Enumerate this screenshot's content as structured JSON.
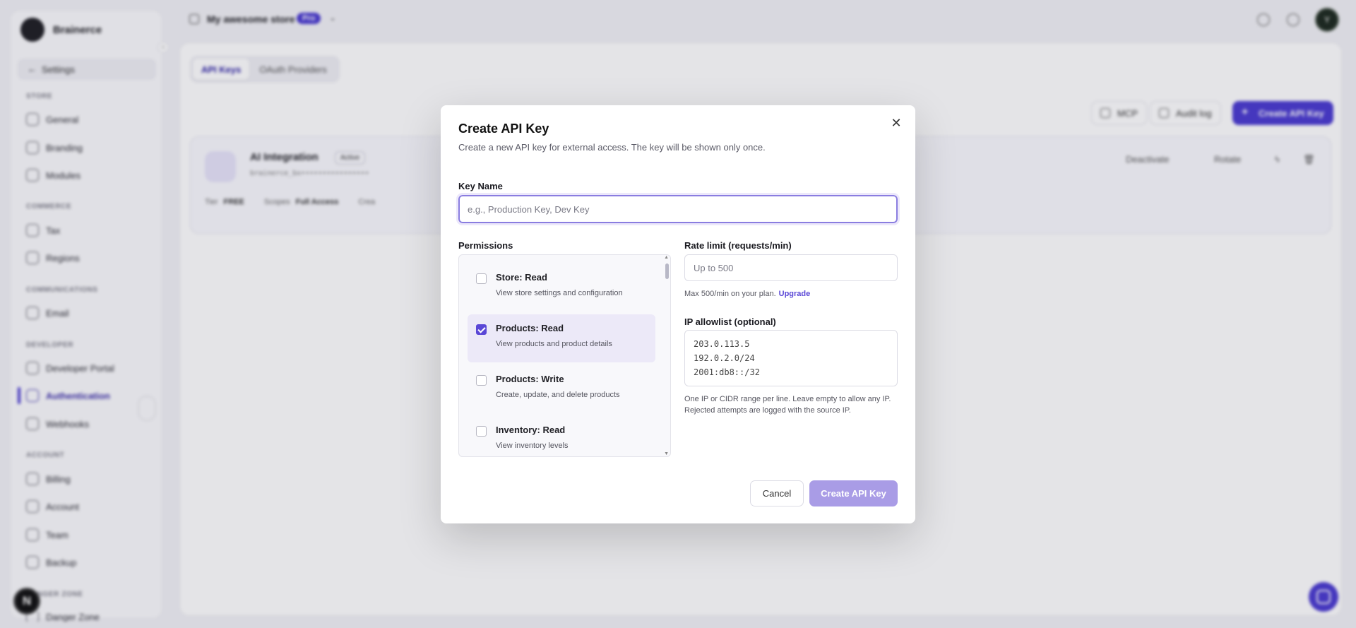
{
  "sidebar": {
    "brand": "Brainerce",
    "back_label": "Settings",
    "sections": {
      "store": "STORE",
      "commerce": "COMMERCE",
      "communications": "COMMUNICATIONS",
      "developer": "DEVELOPER",
      "account": "ACCOUNT",
      "danger": "DANGER ZONE"
    },
    "items": {
      "general": "General",
      "branding": "Branding",
      "modules": "Modules",
      "tax": "Tax",
      "regions": "Regions",
      "email": "Email",
      "developer_portal": "Developer Portal",
      "authentication": "Authentication",
      "webhooks": "Webhooks",
      "billing": "Billing",
      "account": "Account",
      "team": "Team",
      "backup": "Backup",
      "danger_zone": "Danger Zone"
    }
  },
  "topbar": {
    "store_name": "My awesome store",
    "plan_badge": "Pro",
    "avatar_initial": "Y"
  },
  "page": {
    "tabs": [
      "API Keys",
      "OAuth Providers"
    ],
    "buttons": {
      "mcp": "MCP",
      "audit_log": "Audit log",
      "create": "Create API Key"
    },
    "key_card": {
      "name": "AI Integration",
      "status": "Active",
      "masked": "brainerce_bx••••••••••••••••",
      "tier_label": "Tier",
      "tier_value": "FREE",
      "scopes_label": "Scopes",
      "scopes_value": "Full Access",
      "created_label": "Crea",
      "deactivate": "Deactivate",
      "rotate": "Rotate"
    }
  },
  "modal": {
    "title": "Create API Key",
    "subtitle": "Create a new API key for external access. The key will be shown only once.",
    "key_name_label": "Key Name",
    "key_name_placeholder": "e.g., Production Key, Dev Key",
    "permissions_label": "Permissions",
    "permissions": [
      {
        "title": "Store: Read",
        "desc": "View store settings and configuration",
        "checked": false
      },
      {
        "title": "Products: Read",
        "desc": "View products and product details",
        "checked": true
      },
      {
        "title": "Products: Write",
        "desc": "Create, update, and delete products",
        "checked": false
      },
      {
        "title": "Inventory: Read",
        "desc": "View inventory levels",
        "checked": false
      }
    ],
    "rate_label": "Rate limit (requests/min)",
    "rate_placeholder": "Up to 500",
    "rate_help": "Max 500/min on your plan.",
    "upgrade": "Upgrade",
    "ip_label": "IP allowlist (optional)",
    "ip_value": "203.0.113.5\n192.0.2.0/24\n2001:db8::/32",
    "ip_help": "One IP or CIDR range per line. Leave empty to allow any IP. Rejected attempts are logged with the source IP.",
    "cancel": "Cancel",
    "create": "Create API Key"
  },
  "colors": {
    "accent": "#4b3bd1",
    "accent_light": "#a99ce6",
    "checked_bg": "#ece9f8"
  }
}
